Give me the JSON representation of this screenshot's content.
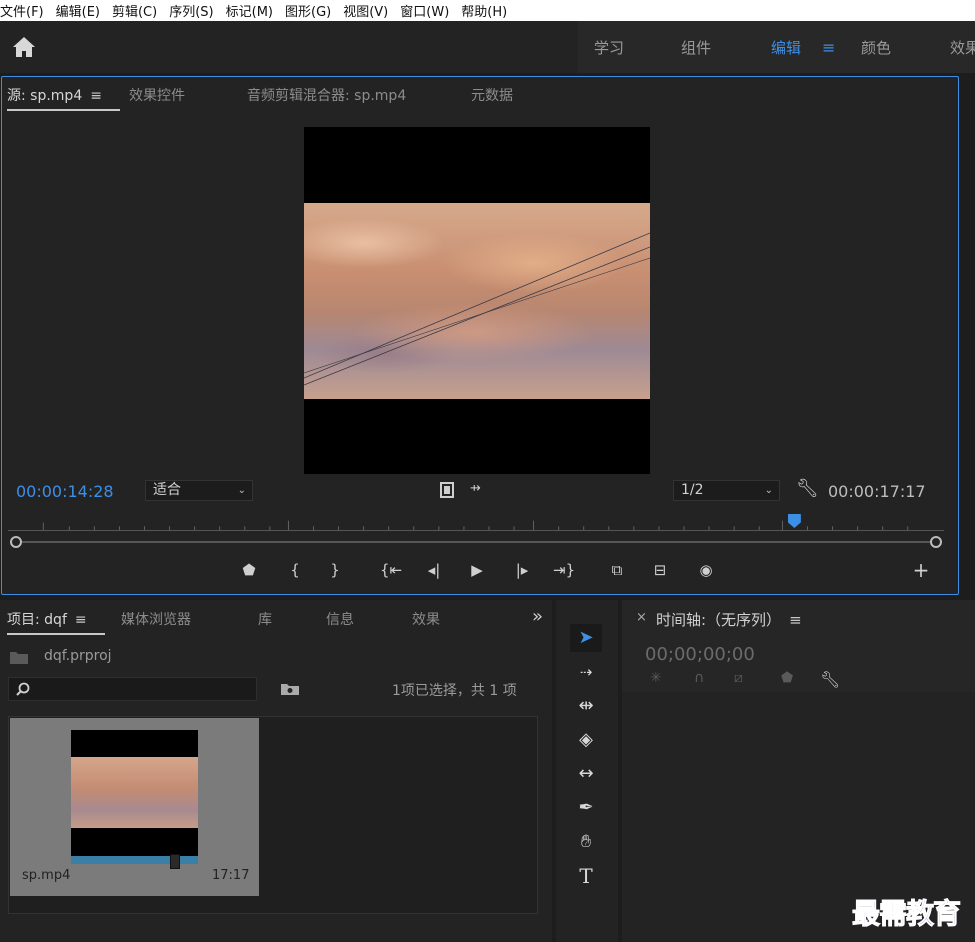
{
  "menu": [
    "文件(F)",
    "编辑(E)",
    "剪辑(C)",
    "序列(S)",
    "标记(M)",
    "图形(G)",
    "视图(V)",
    "窗口(W)",
    "帮助(H)"
  ],
  "workspaces": {
    "learn": "学习",
    "assembly": "组件",
    "editing": "编辑",
    "color": "颜色",
    "effects": "效果"
  },
  "source_panel": {
    "tabs": [
      "源: sp.mp4",
      "效果控件",
      "音频剪辑混合器: sp.mp4",
      "元数据"
    ],
    "timecode_current": "00:00:14:28",
    "zoom_select": "适合",
    "resolution_select": "1/2",
    "timecode_duration": "00:00:17:17",
    "playhead_fraction": 0.845
  },
  "project_panel": {
    "tabs": [
      "项目: dqf",
      "媒体浏览器",
      "库",
      "信息",
      "效果"
    ],
    "more": "»",
    "project_file": "dqf.prproj",
    "search_placeholder": "",
    "selection_count": "1项已选择，共 1 项",
    "clip": {
      "name": "sp.mp4",
      "duration": "17:17"
    }
  },
  "timeline_panel": {
    "close": "×",
    "title": "时间轴:（无序列）",
    "timecode": "00;00;00;00"
  },
  "watermark": "最需教育",
  "colors": {
    "accent": "#3d8fe6",
    "panel": "#232323"
  }
}
